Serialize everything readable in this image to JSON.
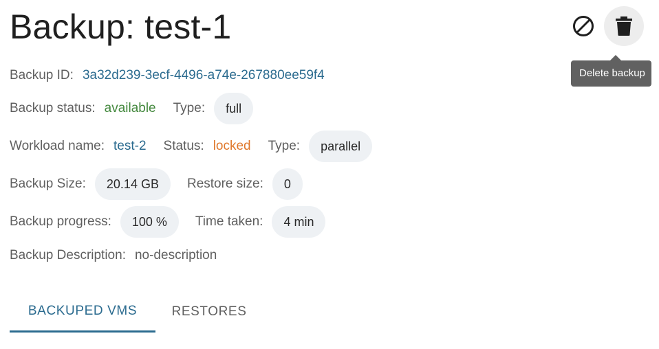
{
  "header": {
    "title": "Backup: test-1",
    "cancel_icon": "block-icon",
    "delete_icon": "trash-icon",
    "tooltip": "Delete backup"
  },
  "details": {
    "backup_id_label": "Backup ID:",
    "backup_id": "3a32d239-3ecf-4496-a74e-267880ee59f4",
    "backup_status_label": "Backup status:",
    "backup_status": "available",
    "backup_type_label": "Type:",
    "backup_type": "full",
    "workload_name_label": "Workload name:",
    "workload_name": "test-2",
    "workload_status_label": "Status:",
    "workload_status": "locked",
    "workload_type_label": "Type:",
    "workload_type": "parallel",
    "backup_size_label": "Backup Size:",
    "backup_size": "20.14 GB",
    "restore_size_label": "Restore size:",
    "restore_size": "0",
    "progress_label": "Backup progress:",
    "progress": "100 %",
    "time_taken_label": "Time taken:",
    "time_taken": "4 min",
    "description_label": "Backup Description:",
    "description": "no-description"
  },
  "tabs": [
    {
      "label": "BACKUPED VMS",
      "active": true
    },
    {
      "label": "RESTORES",
      "active": false
    }
  ],
  "colors": {
    "link": "#2b6b8f",
    "available": "#43883d",
    "locked": "#e0782c",
    "chip_bg": "#eef1f4",
    "tooltip_bg": "#616161"
  }
}
